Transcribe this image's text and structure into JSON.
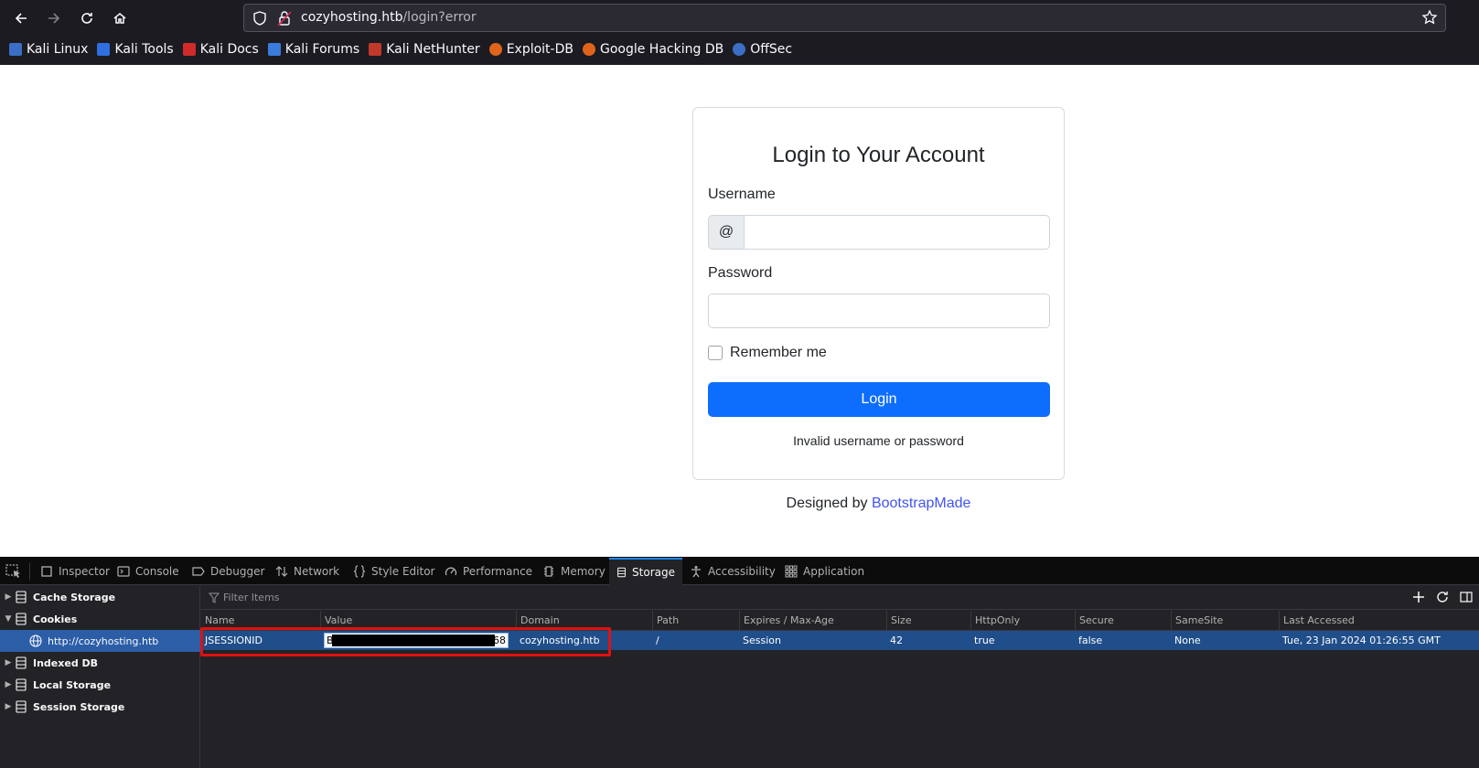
{
  "browser": {
    "url_host": "cozyhosting.htb",
    "url_path": "/login?error",
    "bookmarks": [
      {
        "label": "Kali Linux",
        "color": "#3b6fc6"
      },
      {
        "label": "Kali Tools",
        "color": "#2f6fe0"
      },
      {
        "label": "Kali Docs",
        "color": "#d02a2a"
      },
      {
        "label": "Kali Forums",
        "color": "#3a7cdc"
      },
      {
        "label": "Kali NetHunter",
        "color": "#c0392b"
      },
      {
        "label": "Exploit-DB",
        "color": "#e0641c"
      },
      {
        "label": "Google Hacking DB",
        "color": "#e0641c"
      },
      {
        "label": "OffSec",
        "color": "#3b6fc6"
      }
    ]
  },
  "login": {
    "title": "Login to Your Account",
    "username_label": "Username",
    "username_addon": "@",
    "password_label": "Password",
    "remember_label": "Remember me",
    "button_label": "Login",
    "error_message": "Invalid username or password",
    "credits_prefix": "Designed by ",
    "credits_link": "BootstrapMade"
  },
  "devtools": {
    "tabs": [
      "Inspector",
      "Console",
      "Debugger",
      "Network",
      "Style Editor",
      "Performance",
      "Memory",
      "Storage",
      "Accessibility",
      "Application"
    ],
    "active_tab": "Storage",
    "sidebar": {
      "cache_storage": "Cache Storage",
      "cookies": "Cookies",
      "cookies_origin": "http://cozyhosting.htb",
      "indexed_db": "Indexed DB",
      "local_storage": "Local Storage",
      "session_storage": "Session Storage"
    },
    "filter_placeholder": "Filter Items",
    "columns": [
      "Name",
      "Value",
      "Domain",
      "Path",
      "Expires / Max-Age",
      "Size",
      "HttpOnly",
      "Secure",
      "SameSite",
      "Last Accessed"
    ],
    "cookie": {
      "name": "JSESSIONID",
      "value_start": "B4",
      "value_end": "68",
      "domain": "cozyhosting.htb",
      "path": "/",
      "expires": "Session",
      "size": "42",
      "httponly": "true",
      "secure": "false",
      "samesite": "None",
      "last_accessed": "Tue, 23 Jan 2024 01:26:55 GMT"
    }
  },
  "colors": {
    "accent": "#0d6efd",
    "selection": "#204e8a",
    "highlight": "#e01010"
  }
}
